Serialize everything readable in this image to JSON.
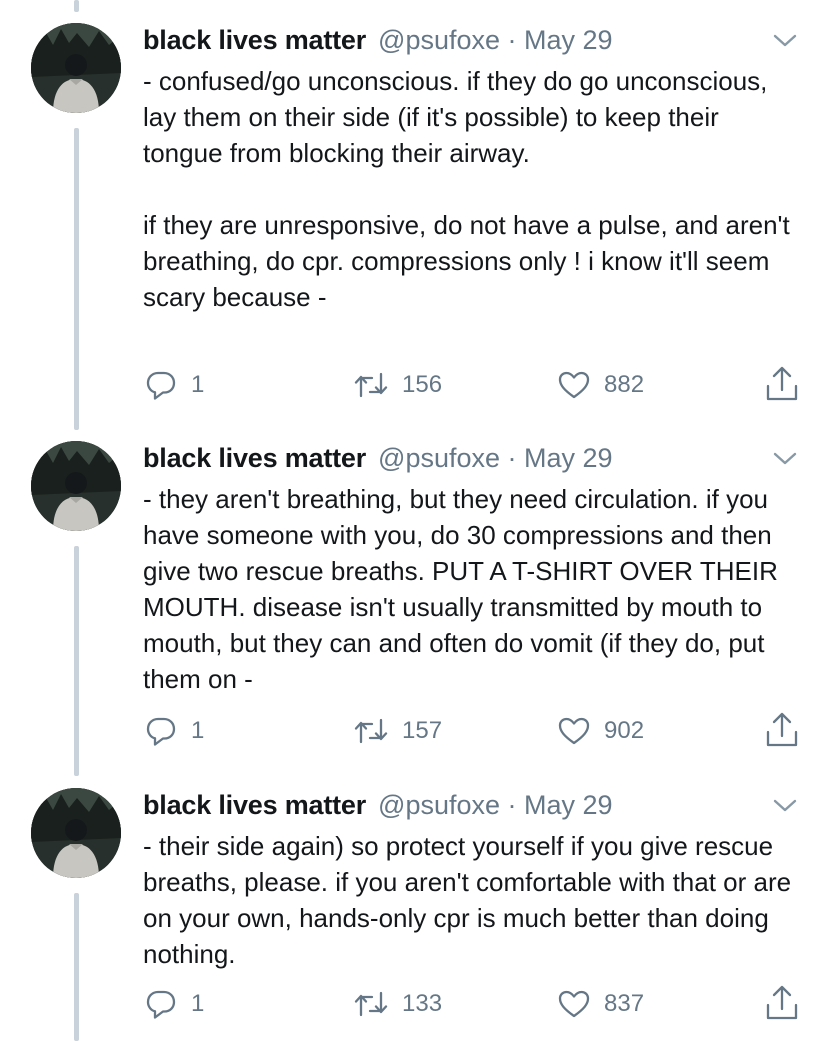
{
  "tweets": [
    {
      "name": "black lives matter",
      "handle": "@psufoxe",
      "date": "May 29",
      "meta": "@psufoxe · May 29",
      "text": "- confused/go unconscious. if they do go unconscious, lay them on their side (if it's possible) to keep their tongue from blocking their airway.\n\nif they are unresponsive, do not have a pulse, and aren't breathing, do cpr. compressions only ! i know it'll seem scary because -",
      "replies": "1",
      "retweets": "156",
      "likes": "882",
      "icons": {
        "avatar": "profile-photo",
        "menu": "chevron-down-icon",
        "reply": "reply-icon",
        "retweet": "retweet-icon",
        "like": "heart-icon",
        "share": "share-icon"
      }
    },
    {
      "name": "black lives matter",
      "handle": "@psufoxe",
      "date": "May 29",
      "meta": "@psufoxe · May 29",
      "text": "- they aren't breathing, but they need circulation. if you have someone with you, do 30 compressions and then give two rescue breaths. PUT A T-SHIRT OVER THEIR MOUTH. disease isn't usually transmitted by mouth to mouth, but they can and often do vomit (if they do, put them on -",
      "replies": "1",
      "retweets": "157",
      "likes": "902",
      "icons": {
        "avatar": "profile-photo",
        "menu": "chevron-down-icon",
        "reply": "reply-icon",
        "retweet": "retweet-icon",
        "like": "heart-icon",
        "share": "share-icon"
      }
    },
    {
      "name": "black lives matter",
      "handle": "@psufoxe",
      "date": "May 29",
      "meta": "@psufoxe · May 29",
      "text": "- their side again) so protect yourself if you give rescue breaths, please. if you aren't comfortable with that or are on your own, hands-only cpr is much better than doing nothing.",
      "replies": "1",
      "retweets": "133",
      "likes": "837",
      "icons": {
        "avatar": "profile-photo",
        "menu": "chevron-down-icon",
        "reply": "reply-icon",
        "retweet": "retweet-icon",
        "like": "heart-icon",
        "share": "share-icon"
      }
    }
  ],
  "colors": {
    "text": "#14171a",
    "secondary": "#657786",
    "thread_line": "#c9d2da",
    "background": "#ffffff"
  }
}
